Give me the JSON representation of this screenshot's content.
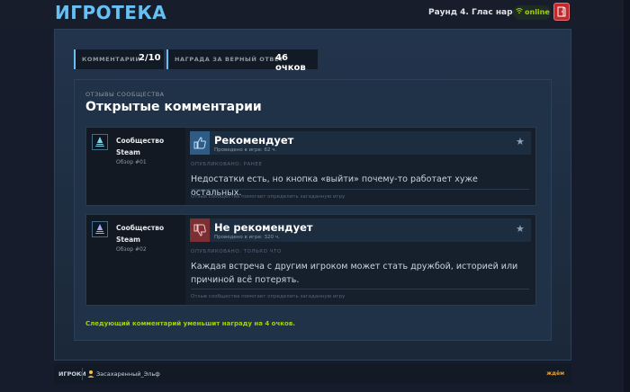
{
  "header": {
    "logo": "ИГРОТЕКА",
    "round": "Раунд 4. Глас народа",
    "status": "online",
    "colors": {
      "accent": "#66c0f4",
      "online": "#a4d007",
      "exit": "#c2282c"
    }
  },
  "stats": {
    "comments_label": "КОММЕНТАРИИ",
    "comments_value": "2/10",
    "reward_label": "НАГРАДА ЗА ВЕРНЫЙ ОТВЕТ",
    "reward_value": "46 очков"
  },
  "reviews_section": {
    "kicker": "ОТЗЫВЫ СООБЩЕСТВА",
    "title": "Открытые комментарии",
    "reviews": [
      {
        "author": "Сообщество Steam",
        "number": "Обзор #01",
        "verdict": "Рекомендует",
        "verdict_icon": "thumbs-up-icon",
        "hours": "Проведено в игре: 62 ч.",
        "posted": "ОПУБЛИКОВАНО: РАНЕЕ",
        "text": "Недостатки есть, но кнопка «выйти» почему-то работает хуже остальных.",
        "footer": "Отзыв сообщества помогает определить загаданную игру"
      },
      {
        "author": "Сообщество Steam",
        "number": "Обзор #02",
        "verdict": "Не рекомендует",
        "verdict_icon": "thumbs-down-icon",
        "hours": "Проведено в игре: 320 ч.",
        "posted": "ОПУБЛИКОВАНО: ТОЛЬКО ЧТО",
        "text": "Каждая встреча с другим игроком может стать дружбой, историей или причиной всё потерять.",
        "footer": "Отзыв сообщества помогает определить загаданную игру"
      }
    ],
    "hint": "Следующий комментарий уменьшит награду на 4 очков."
  },
  "players": {
    "label": "ИГРОКИ",
    "list": [
      {
        "name": "Засахаренный_Эльф"
      }
    ],
    "status": "ждём"
  }
}
